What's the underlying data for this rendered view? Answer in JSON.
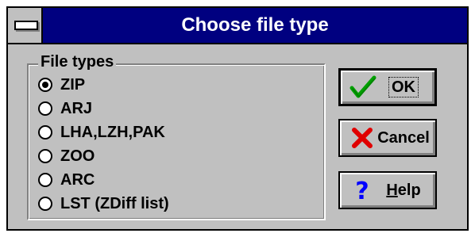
{
  "window": {
    "title": "Choose file type"
  },
  "group": {
    "label": "File types",
    "options": [
      {
        "label": "ZIP",
        "selected": true
      },
      {
        "label": "ARJ",
        "selected": false
      },
      {
        "label": "LHA,LZH,PAK",
        "selected": false
      },
      {
        "label": "ZOO",
        "selected": false
      },
      {
        "label": "ARC",
        "selected": false
      },
      {
        "label": "LST (ZDiff list)",
        "selected": false
      }
    ]
  },
  "buttons": {
    "ok": {
      "label": "OK",
      "icon": "checkmark-icon",
      "color": "#00a000"
    },
    "cancel": {
      "label": "Cancel",
      "icon": "x-icon",
      "color": "#e00000"
    },
    "help": {
      "label_first": "H",
      "label_rest": "elp",
      "icon": "question-icon",
      "color": "#0000ff"
    }
  }
}
